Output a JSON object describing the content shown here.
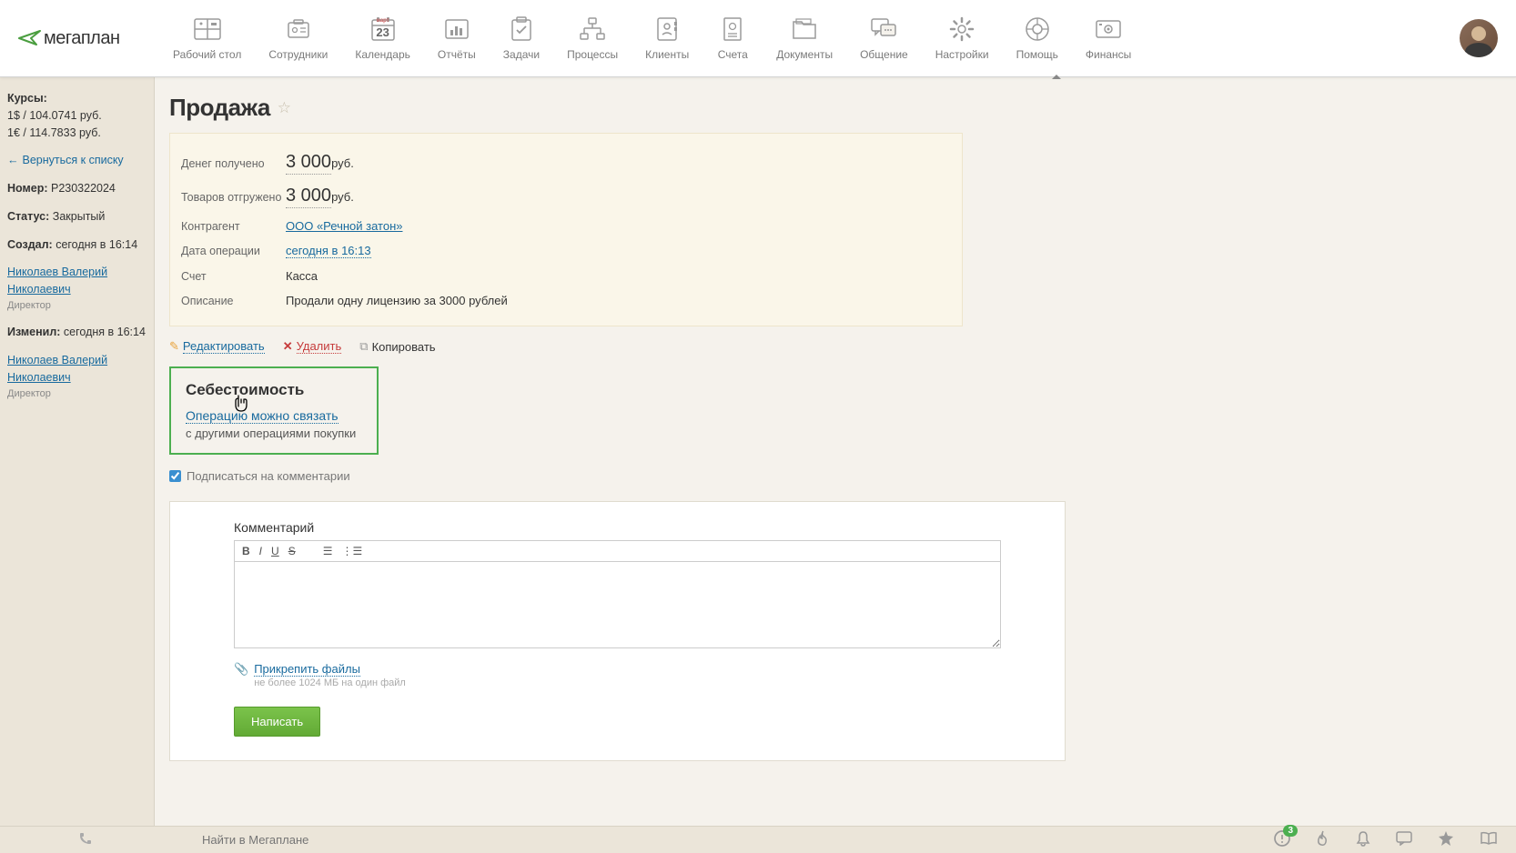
{
  "logo": "мегаплан",
  "nav": [
    {
      "label": "Рабочий стол",
      "icon": "dashboard-icon"
    },
    {
      "label": "Сотрудники",
      "icon": "employees-icon"
    },
    {
      "label": "Календарь",
      "icon": "calendar-icon",
      "day": "23",
      "month": "март"
    },
    {
      "label": "Отчёты",
      "icon": "reports-icon"
    },
    {
      "label": "Задачи",
      "icon": "tasks-icon"
    },
    {
      "label": "Процессы",
      "icon": "processes-icon"
    },
    {
      "label": "Клиенты",
      "icon": "clients-icon"
    },
    {
      "label": "Счета",
      "icon": "invoices-icon"
    },
    {
      "label": "Документы",
      "icon": "documents-icon"
    },
    {
      "label": "Общение",
      "icon": "chat-icon"
    },
    {
      "label": "Настройки",
      "icon": "settings-icon"
    },
    {
      "label": "Помощь",
      "icon": "help-icon"
    },
    {
      "label": "Финансы",
      "icon": "finance-icon"
    }
  ],
  "sidebar": {
    "rates_title": "Курсы:",
    "rate_usd": "1$ / 104.0741 руб.",
    "rate_eur": "1€ / 114.7833 руб.",
    "back": "Вернуться к списку",
    "number_label": "Номер:",
    "number": "Р230322024",
    "status_label": "Статус:",
    "status": "Закрытый",
    "created_label": "Создал:",
    "created": "сегодня в 16:14",
    "creator": "Николаев Валерий Николаевич",
    "role": "Директор",
    "modified_label": "Изменил:",
    "modified": "сегодня в 16:14",
    "modifier": "Николаев Валерий Николаевич"
  },
  "main": {
    "title": "Продажа",
    "rows": {
      "money_received_label": "Денег получено",
      "money_received": "3 000",
      "money_currency": "руб.",
      "goods_shipped_label": "Товаров отгружено",
      "goods_shipped": "3 000",
      "contractor_label": "Контрагент",
      "contractor": "ООО «Речной затон»",
      "date_label": "Дата операции",
      "date": "сегодня в 16:13",
      "account_label": "Счет",
      "account": "Касса",
      "description_label": "Описание",
      "description": "Продали одну лицензию за 3000 рублей"
    },
    "actions": {
      "edit": "Редактировать",
      "delete": "Удалить",
      "copy": "Копировать"
    },
    "cost_block": {
      "title": "Себестоимость",
      "link": "Операцию можно связать",
      "hint": "с другими операциями покупки"
    },
    "subscribe": "Подписаться на комментарии",
    "comment": {
      "title": "Комментарий",
      "attach": "Прикрепить файлы",
      "attach_hint": "не более 1024 МБ на один файл",
      "submit": "Написать"
    }
  },
  "footer": {
    "search_placeholder": "Найти в Мегаплане",
    "notif_count": "3"
  }
}
